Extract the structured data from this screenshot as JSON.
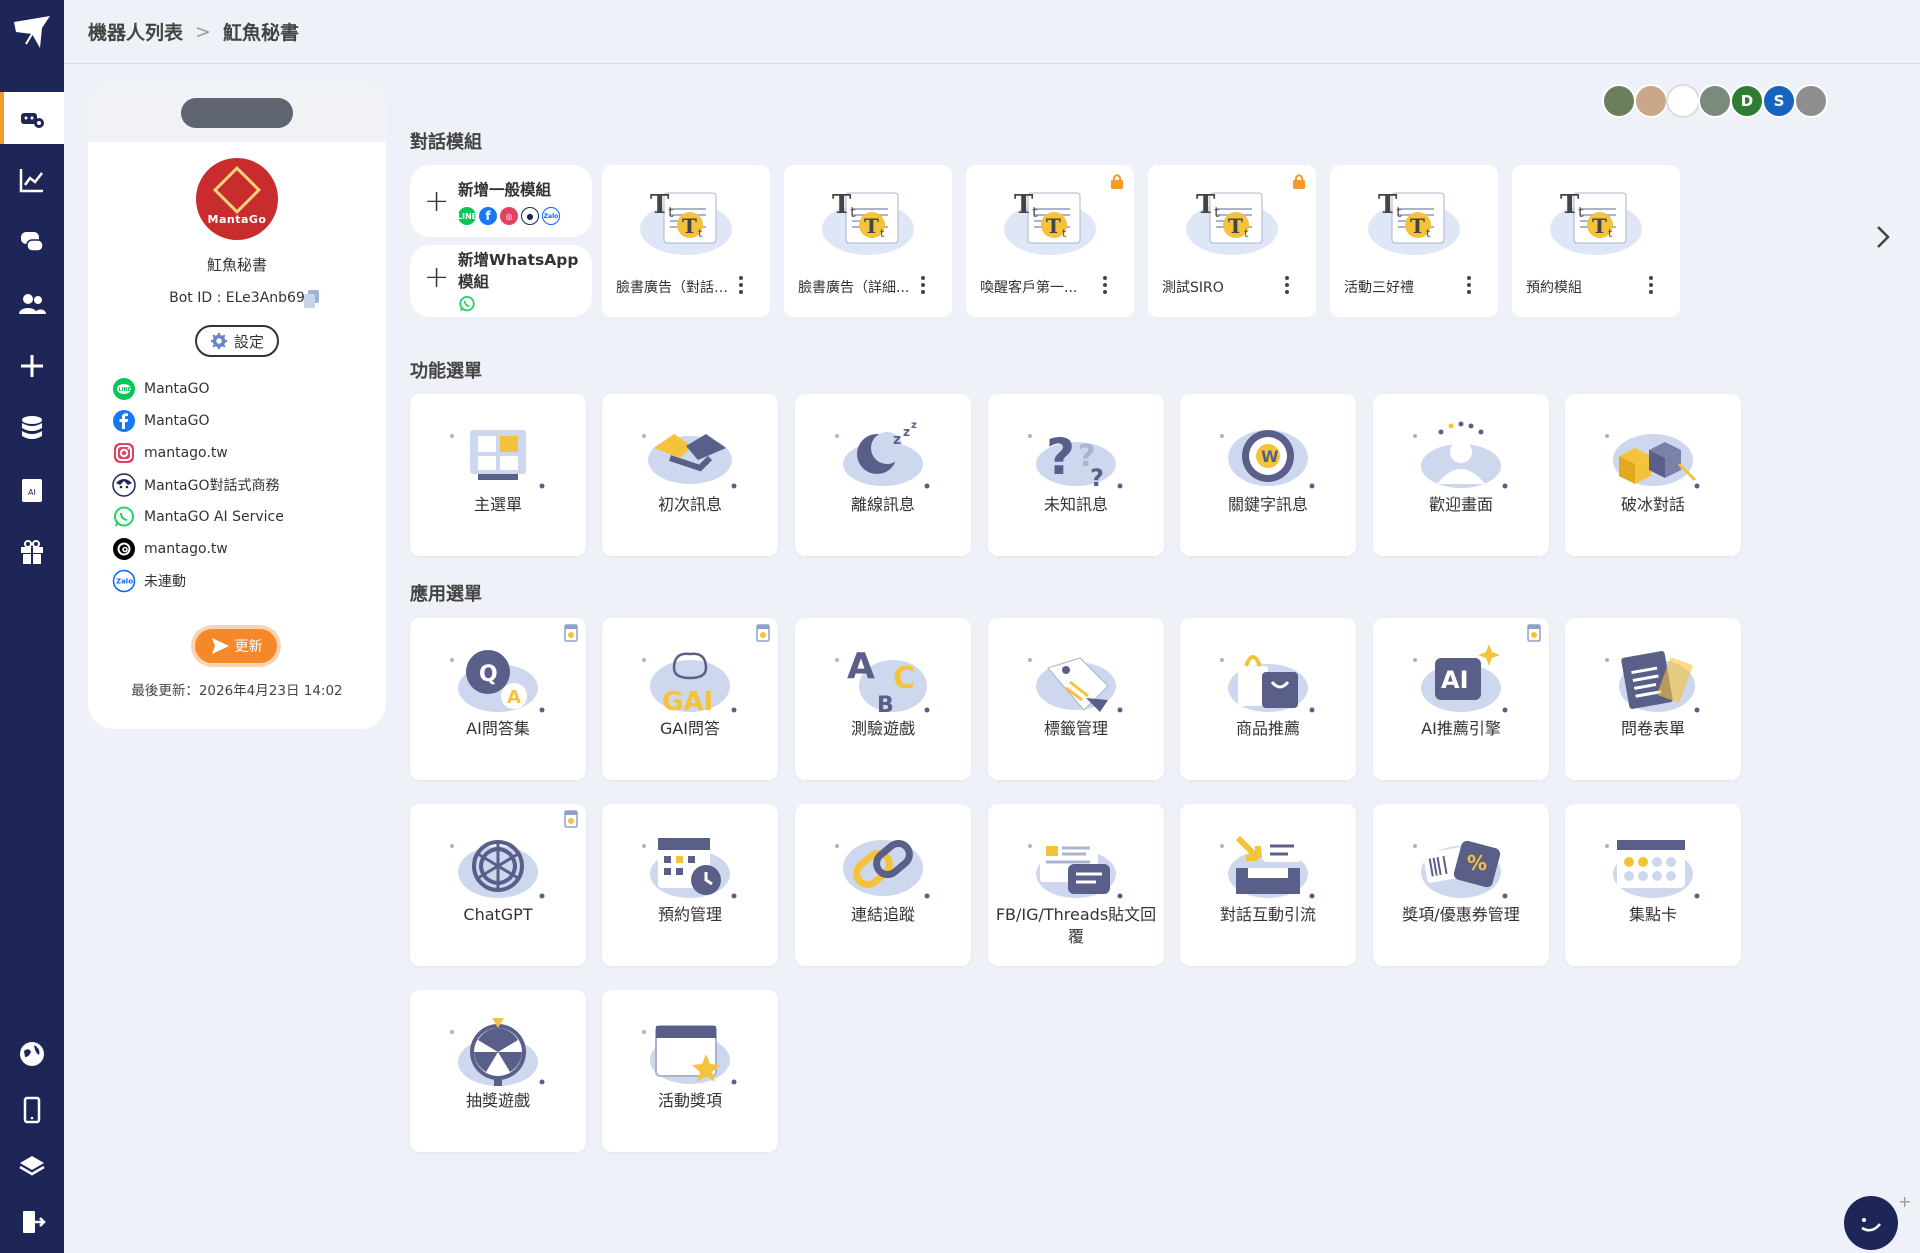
{
  "breadcrumb": {
    "root": "機器人列表",
    "separator": ">",
    "current": "魟魚秘書"
  },
  "rail": {
    "top_items": [
      "robot-settings-icon",
      "analytics-chart-icon",
      "chat-bubbles-icon",
      "users-icon",
      "add-icon",
      "database-icon",
      "ai-document-icon",
      "gift-icon"
    ],
    "bottom_items": [
      "globe-icon",
      "tablet-icon",
      "layers-icon",
      "logout-icon"
    ],
    "active": "robot-settings-icon"
  },
  "bot": {
    "name": "魟魚秘書",
    "bot_id": "Bot ID : ELe3Anb69",
    "avatar_text": "MantaGo",
    "settings_label": "設定",
    "channels": [
      {
        "platform": "LINE",
        "label": "MantaGO",
        "color": "#06c755"
      },
      {
        "platform": "Facebook",
        "label": "MantaGO",
        "color": "#1877f2"
      },
      {
        "platform": "Instagram",
        "label": "mantago.tw",
        "color": "#e4405f"
      },
      {
        "platform": "Messenger bot",
        "label": "MantaGO對話式商務",
        "color": "#1e2557"
      },
      {
        "platform": "WhatsApp",
        "label": "MantaGO AI Service",
        "color": "#25d366"
      },
      {
        "platform": "Threads",
        "label": "mantago.tw",
        "color": "#000000"
      },
      {
        "platform": "Zalo",
        "label": "未連動",
        "color": "#0068ff"
      }
    ],
    "update_label": "更新",
    "last_updated": "最後更新：2026年4月23日 14:02"
  },
  "collaborators": [
    {
      "initial": "",
      "color": "#6b7f5c"
    },
    {
      "initial": "",
      "color": "#c9a788"
    },
    {
      "initial": "",
      "color": "#ffffff"
    },
    {
      "initial": "",
      "color": "#7a8a7d"
    },
    {
      "initial": "D",
      "color": "#2e7d32"
    },
    {
      "initial": "S",
      "color": "#1565c0"
    },
    {
      "initial": "",
      "color": "#8e8e8e"
    }
  ],
  "sections": {
    "modules": "對話模組",
    "features": "功能選單",
    "apps": "應用選單"
  },
  "new_modules": {
    "general": "新增一般模組",
    "whatsapp": "新增WhatsApp模組"
  },
  "modules": [
    {
      "label": "臉書廣告（對話式...",
      "locked": false
    },
    {
      "label": "臉書廣告（詳細...",
      "locked": false
    },
    {
      "label": "喚醒客戶第一...",
      "locked": true
    },
    {
      "label": "測試SIRO",
      "locked": true
    },
    {
      "label": "活動三好禮",
      "locked": false
    },
    {
      "label": "預約模組",
      "locked": false
    }
  ],
  "features": [
    {
      "label": "主選單",
      "icon": "menu-grid-icon"
    },
    {
      "label": "初次訊息",
      "icon": "handshake-icon"
    },
    {
      "label": "離線訊息",
      "icon": "sleep-moon-icon"
    },
    {
      "label": "未知訊息",
      "icon": "question-marks-icon"
    },
    {
      "label": "關鍵字訊息",
      "icon": "keyword-target-icon"
    },
    {
      "label": "歡迎畫面",
      "icon": "welcome-person-icon"
    },
    {
      "label": "破冰對話",
      "icon": "ice-cubes-icon"
    }
  ],
  "apps": [
    {
      "label": "AI問答集",
      "icon": "qa-bubbles-icon",
      "badge": true
    },
    {
      "label": "GAI問答",
      "icon": "gai-brain-icon",
      "badge": true
    },
    {
      "label": "測驗遊戲",
      "icon": "abc-quiz-icon",
      "badge": false
    },
    {
      "label": "標籤管理",
      "icon": "tag-icon",
      "badge": false
    },
    {
      "label": "商品推薦",
      "icon": "shopping-bag-icon",
      "badge": false
    },
    {
      "label": "AI推薦引擎",
      "icon": "ai-sparkle-icon",
      "badge": true
    },
    {
      "label": "問卷表單",
      "icon": "survey-form-icon",
      "badge": false
    },
    {
      "label": "ChatGPT",
      "icon": "chatgpt-icon",
      "badge": true
    },
    {
      "label": "預約管理",
      "icon": "calendar-clock-icon",
      "badge": false
    },
    {
      "label": "連結追蹤",
      "icon": "chain-link-icon",
      "badge": false
    },
    {
      "label": "FB/IG/Threads貼文回覆",
      "icon": "post-reply-icon",
      "badge": false
    },
    {
      "label": "對話互動引流",
      "icon": "inbox-arrow-icon",
      "badge": false
    },
    {
      "label": "獎項/優惠券管理",
      "icon": "coupon-icon",
      "badge": false
    },
    {
      "label": "集點卡",
      "icon": "stamp-card-icon",
      "badge": false
    },
    {
      "label": "抽獎遊戲",
      "icon": "prize-wheel-icon",
      "badge": false
    },
    {
      "label": "活動獎項",
      "icon": "calendar-star-icon",
      "badge": false
    }
  ],
  "colors": {
    "navy": "#1e2557",
    "accent": "#f39a2b",
    "page_bg": "#eff1f8",
    "illustration_light": "#cdd8ee",
    "illustration_dark": "#5a5f8a",
    "illustration_yellow": "#f5c33b"
  }
}
